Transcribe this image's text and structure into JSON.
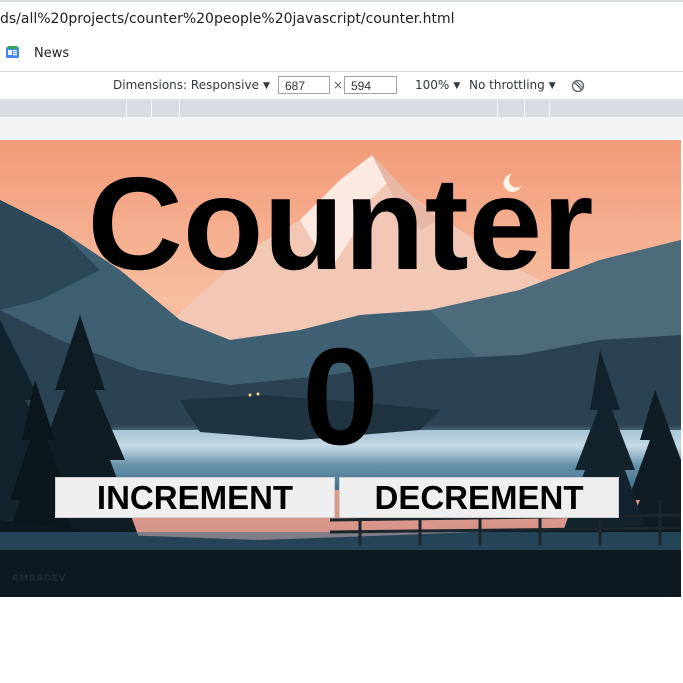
{
  "browser": {
    "url": "ds/all%20projects/counter%20people%20javascript/counter.html",
    "bookmarks": [
      {
        "label": "News",
        "icon": "google-news-icon"
      }
    ]
  },
  "devtools": {
    "dimensions_label": "Dimensions: Responsive",
    "width": "687",
    "times": "×",
    "height": "594",
    "zoom": "100%",
    "throttling": "No throttling",
    "rotate_icon": "rotate-icon"
  },
  "page": {
    "title": "Counter",
    "count": "0",
    "increment_label": "INCREMENT",
    "decrement_label": "DECREMENT",
    "watermark": "RMRADEV"
  },
  "colors": {
    "sky_top": "#f4a07e",
    "sky_mid": "#f7c2a3",
    "mountain": "#2e4b5c",
    "lake": "#6d9bb8",
    "forest": "#0f1c24",
    "button_bg": "#efeff0"
  }
}
